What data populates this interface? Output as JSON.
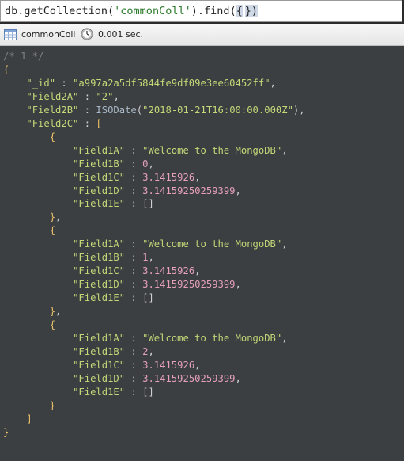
{
  "query": {
    "prefix": "db.getCollection(",
    "collection": "'commonColl'",
    "method": ").find(",
    "open_paren": "{",
    "close_paren": "})"
  },
  "toolbar": {
    "collection_name": "commonColl",
    "elapsed": "0.001 sec."
  },
  "result": {
    "comment": "/* 1 */",
    "id_key": "\"_id\"",
    "id_value": "\"a997a2a5df5844fe9df09e3ee60452ff\"",
    "f2a_key": "\"Field2A\"",
    "f2a_value": "\"2\"",
    "f2b_key": "\"Field2B\"",
    "f2b_fn": "ISODate",
    "f2b_value": "\"2018-01-21T16:00:00.000Z\"",
    "f2c_key": "\"Field2C\"",
    "items": [
      {
        "f1a_key": "\"Field1A\"",
        "f1a": "\"Welcome to the MongoDB\"",
        "f1b_key": "\"Field1B\"",
        "f1b": "0",
        "f1c_key": "\"Field1C\"",
        "f1c": "3.1415926",
        "f1d_key": "\"Field1D\"",
        "f1d": "3.14159250259399",
        "f1e_key": "\"Field1E\"",
        "f1e": "[]"
      },
      {
        "f1a_key": "\"Field1A\"",
        "f1a": "\"Welcome to the MongoDB\"",
        "f1b_key": "\"Field1B\"",
        "f1b": "1",
        "f1c_key": "\"Field1C\"",
        "f1c": "3.1415926",
        "f1d_key": "\"Field1D\"",
        "f1d": "3.14159250259399",
        "f1e_key": "\"Field1E\"",
        "f1e": "[]"
      },
      {
        "f1a_key": "\"Field1A\"",
        "f1a": "\"Welcome to the MongoDB\"",
        "f1b_key": "\"Field1B\"",
        "f1b": "2",
        "f1c_key": "\"Field1C\"",
        "f1c": "3.1415926",
        "f1d_key": "\"Field1D\"",
        "f1d": "3.14159250259399",
        "f1e_key": "\"Field1E\"",
        "f1e": "[]"
      }
    ]
  },
  "icons": {
    "collection": "table-grid-icon",
    "time": "clock-icon"
  }
}
